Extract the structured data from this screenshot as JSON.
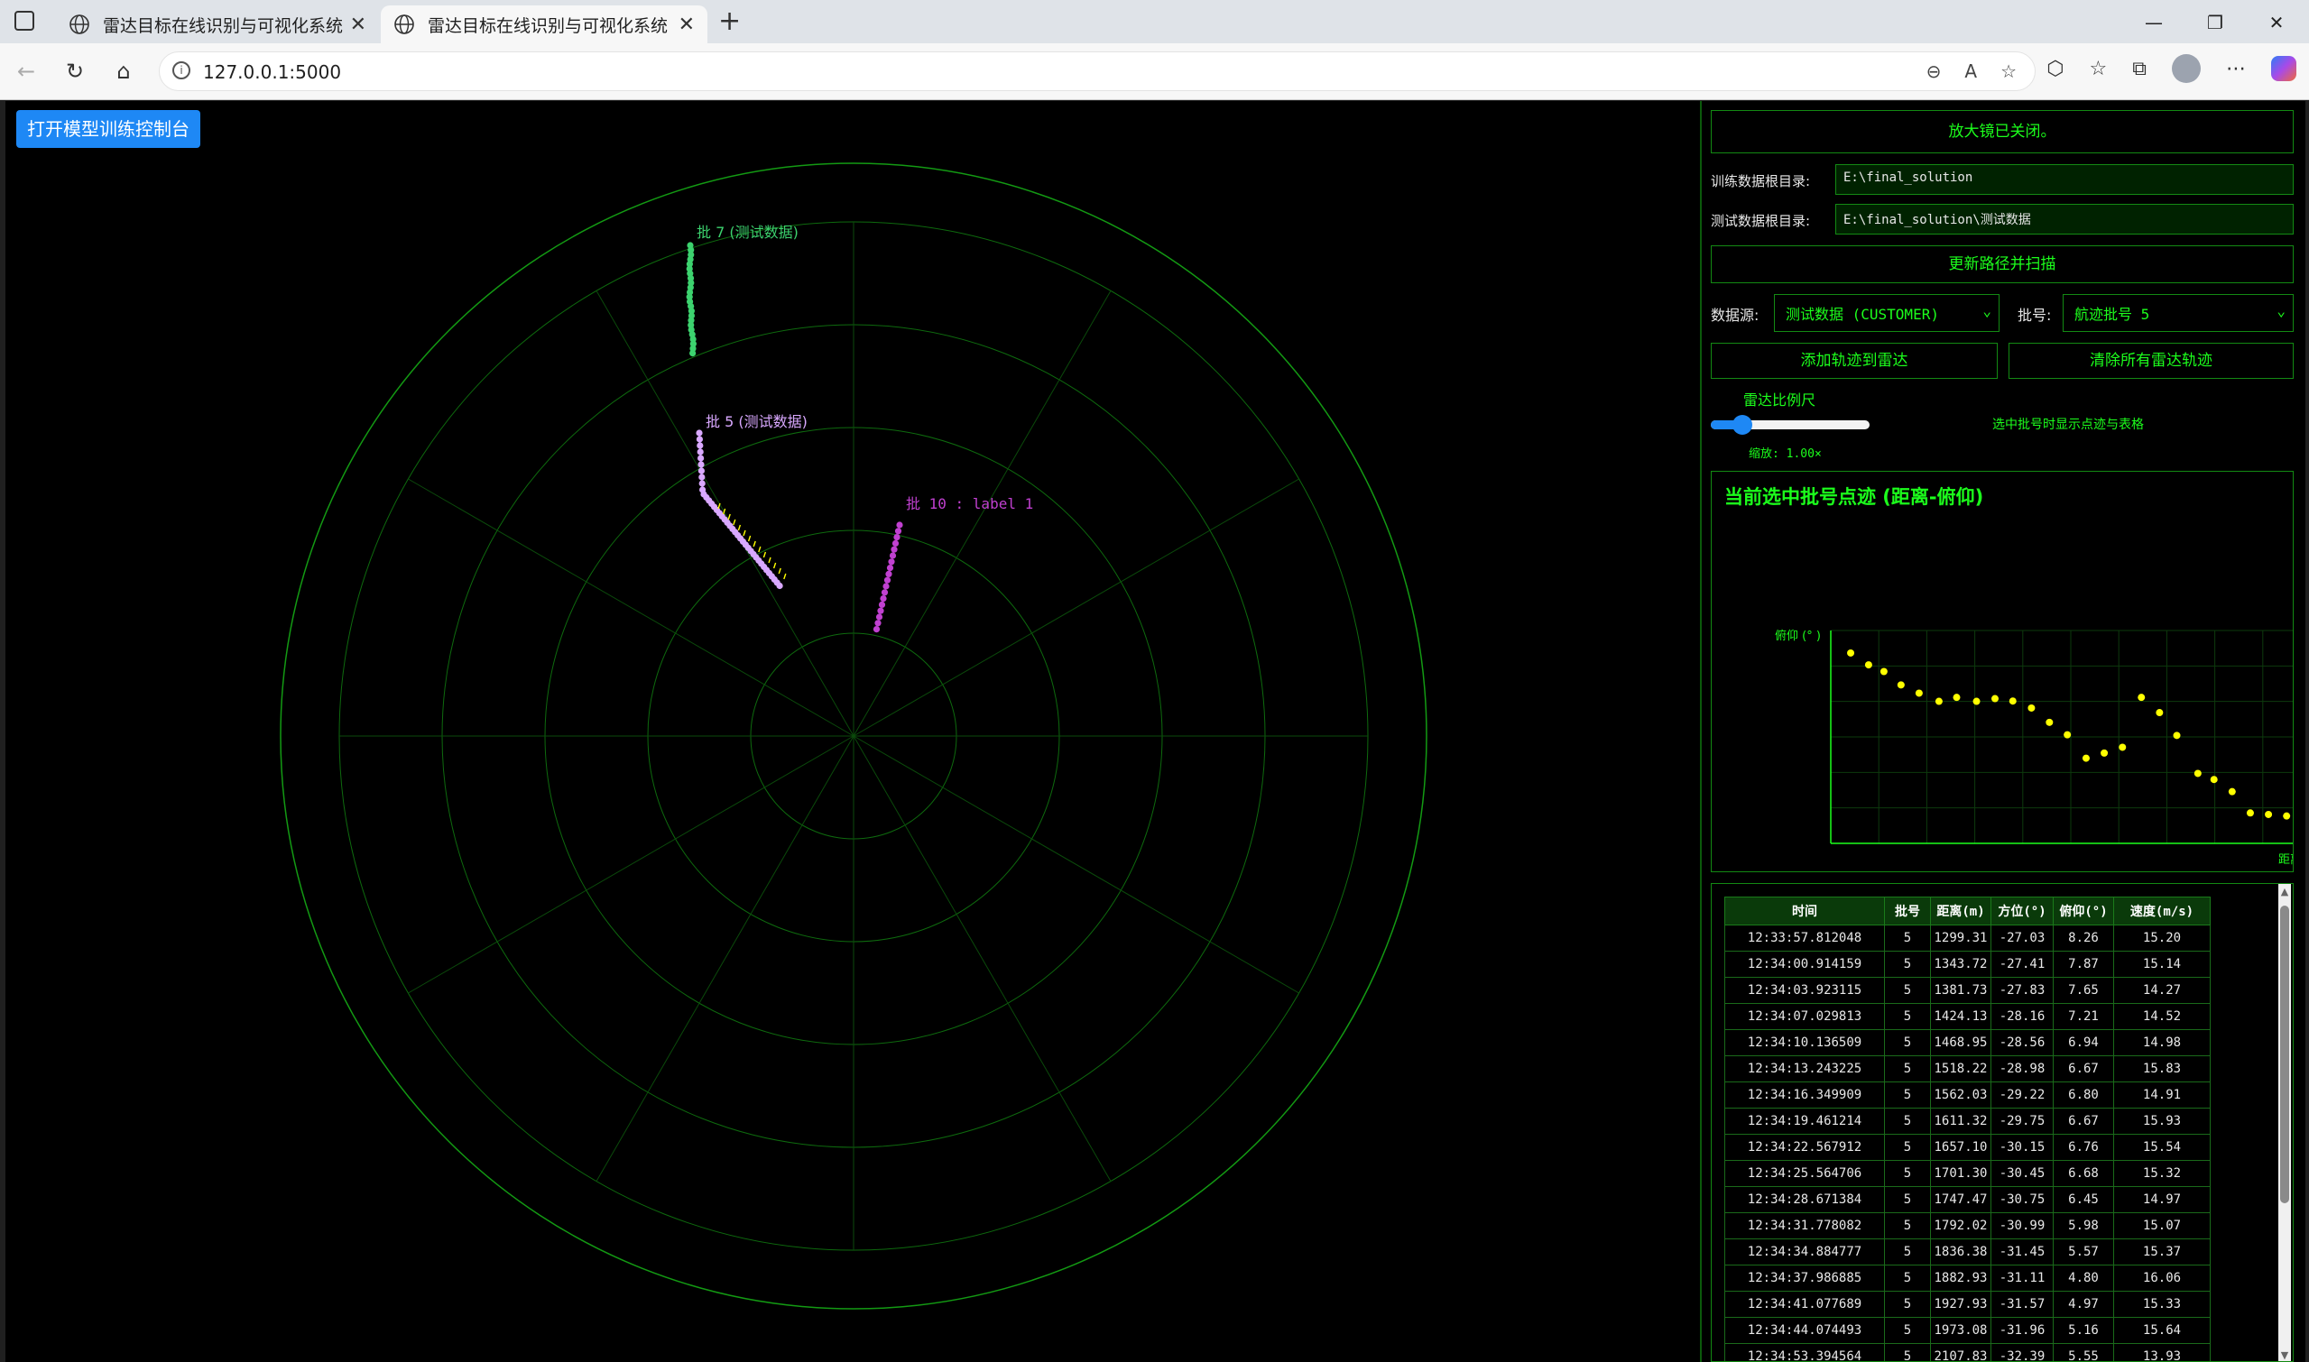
{
  "browser": {
    "tabs": [
      {
        "label": "雷达目标在线识别与可视化系统",
        "active": false
      },
      {
        "label": "雷达目标在线识别与可视化系统",
        "active": true
      }
    ],
    "new_tab": "+",
    "url": "127.0.0.1:5000",
    "window_controls": {
      "minimize": "—",
      "restore": "❐",
      "close": "✕"
    }
  },
  "page": {
    "train_button": "打开模型训练控制台",
    "radar": {
      "tracks": [
        {
          "label": "批 7 (测试数据)",
          "color": "#3cd26e"
        },
        {
          "label": "批 5 (测试数据)",
          "color": "#d9a8ff"
        },
        {
          "label": "批 10 : label 1",
          "color": "#c040d0"
        }
      ]
    }
  },
  "side": {
    "magnifier_status": "放大镜已关闭。",
    "train_dir_label": "训练数据根目录:",
    "train_dir_value": "E:\\final_solution",
    "test_dir_label": "测试数据根目录:",
    "test_dir_value": "E:\\final_solution\\测试数据",
    "update_button": "更新路径并扫描",
    "source_label": "数据源:",
    "source_value": "测试数据 (CUSTOMER)",
    "batch_label": "批号:",
    "batch_value": "航迹批号 5",
    "add_button": "添加轨迹到雷达",
    "clear_button": "清除所有雷达轨迹",
    "scale_label": "雷达比例尺",
    "scale_hint": "选中批号时显示点迹与表格",
    "zoom_text": "缩放: 1.00×",
    "zoom_value": 1.0,
    "chart_title": "当前选中批号点迹 (距离-俯仰)"
  },
  "chart_data": {
    "type": "scatter",
    "title": "当前选中批号点迹 (距离-俯仰)",
    "xlabel": "距离 (m)",
    "ylabel": "俯仰 (° )",
    "grid": true,
    "series": [
      {
        "color": "#ffff00",
        "x": [
          1299.31,
          1343.72,
          1381.73,
          1424.13,
          1468.95,
          1518.22,
          1562.03,
          1611.32,
          1657.1,
          1701.3,
          1747.47,
          1792.02,
          1836.38,
          1882.93,
          1927.93,
          1973.08,
          2107.83,
          2020,
          2065,
          2160,
          2200,
          2245,
          2290,
          2335,
          2380
        ],
        "y": [
          8.26,
          7.87,
          7.65,
          7.21,
          6.94,
          6.67,
          6.8,
          6.67,
          6.76,
          6.68,
          6.45,
          5.98,
          5.57,
          4.8,
          4.97,
          5.16,
          5.55,
          6.8,
          6.3,
          4.3,
          4.1,
          3.7,
          3.0,
          2.95,
          2.9
        ]
      }
    ]
  },
  "table": {
    "headers": [
      "时间",
      "批号",
      "距离(m)",
      "方位(°)",
      "俯仰(°)",
      "速度(m/s)"
    ],
    "rows": [
      [
        "12:33:57.812048",
        "5",
        "1299.31",
        "-27.03",
        "8.26",
        "15.20"
      ],
      [
        "12:34:00.914159",
        "5",
        "1343.72",
        "-27.41",
        "7.87",
        "15.14"
      ],
      [
        "12:34:03.923115",
        "5",
        "1381.73",
        "-27.83",
        "7.65",
        "14.27"
      ],
      [
        "12:34:07.029813",
        "5",
        "1424.13",
        "-28.16",
        "7.21",
        "14.52"
      ],
      [
        "12:34:10.136509",
        "5",
        "1468.95",
        "-28.56",
        "6.94",
        "14.98"
      ],
      [
        "12:34:13.243225",
        "5",
        "1518.22",
        "-28.98",
        "6.67",
        "15.83"
      ],
      [
        "12:34:16.349909",
        "5",
        "1562.03",
        "-29.22",
        "6.80",
        "14.91"
      ],
      [
        "12:34:19.461214",
        "5",
        "1611.32",
        "-29.75",
        "6.67",
        "15.93"
      ],
      [
        "12:34:22.567912",
        "5",
        "1657.10",
        "-30.15",
        "6.76",
        "15.54"
      ],
      [
        "12:34:25.564706",
        "5",
        "1701.30",
        "-30.45",
        "6.68",
        "15.32"
      ],
      [
        "12:34:28.671384",
        "5",
        "1747.47",
        "-30.75",
        "6.45",
        "14.97"
      ],
      [
        "12:34:31.778082",
        "5",
        "1792.02",
        "-30.99",
        "5.98",
        "15.07"
      ],
      [
        "12:34:34.884777",
        "5",
        "1836.38",
        "-31.45",
        "5.57",
        "15.37"
      ],
      [
        "12:34:37.986885",
        "5",
        "1882.93",
        "-31.11",
        "4.80",
        "16.06"
      ],
      [
        "12:34:41.077689",
        "5",
        "1927.93",
        "-31.57",
        "4.97",
        "15.33"
      ],
      [
        "12:34:44.074493",
        "5",
        "1973.08",
        "-31.96",
        "5.16",
        "15.64"
      ],
      [
        "12:34:53.394564",
        "5",
        "2107.83",
        "-32.39",
        "5.55",
        "13.93"
      ]
    ]
  }
}
